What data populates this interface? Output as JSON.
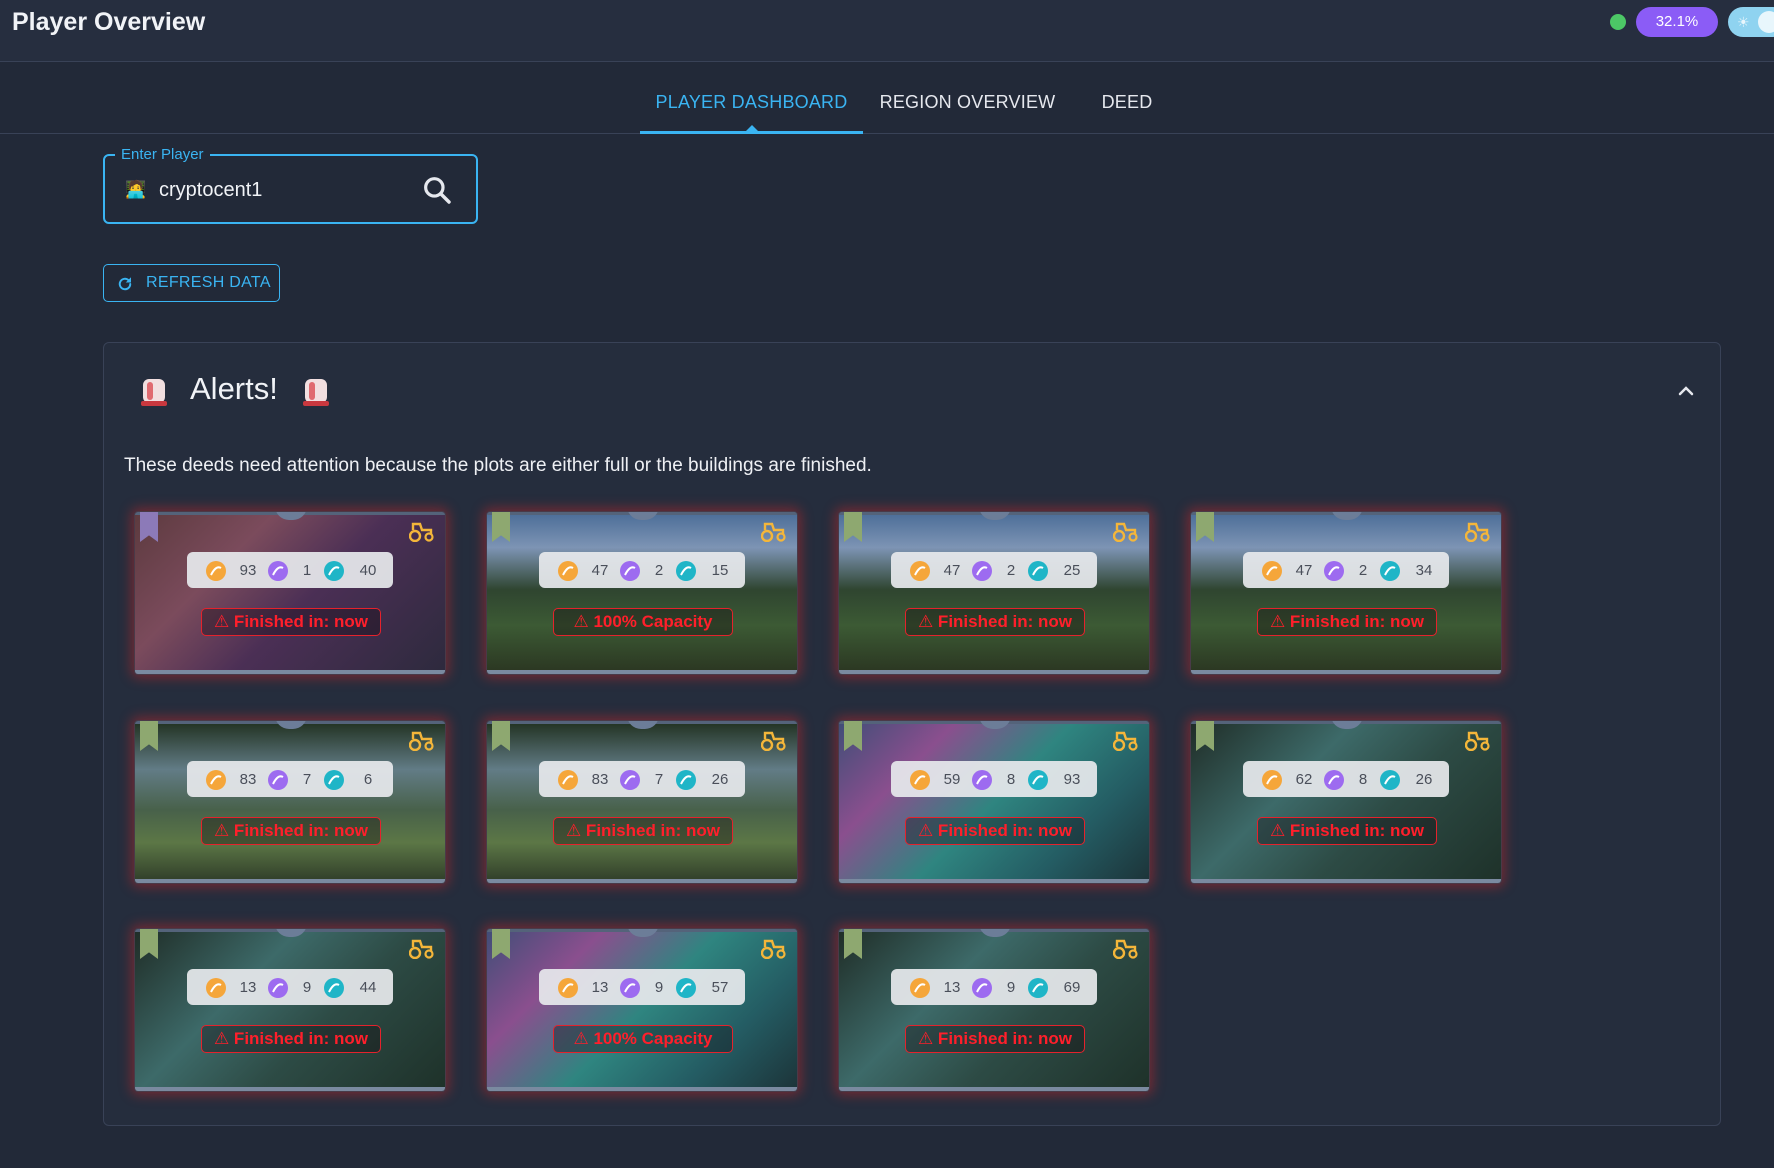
{
  "app": {
    "title": "Player Overview",
    "progress_chip": "32.1%",
    "status_color": "#4cc766",
    "chip_color": "#8b5cf6",
    "accent_color": "#3ab4f2"
  },
  "tabs": [
    {
      "label": "PLAYER DASHBOARD",
      "active": true
    },
    {
      "label": "REGION OVERVIEW",
      "active": false
    },
    {
      "label": "DEED",
      "active": false
    }
  ],
  "player_input": {
    "legend": "Enter Player",
    "value": "cryptocent1"
  },
  "refresh_button": {
    "label": "REFRESH DATA"
  },
  "alerts": {
    "title": "Alerts!",
    "description": "These deeds need attention because the plots are either full or the buildings are finished.",
    "cards": [
      {
        "biome": "death",
        "banner": "purple",
        "grain": "93",
        "research": "1",
        "spellpower": "40",
        "alert": "⚠ Finished in: now"
      },
      {
        "biome": "forest",
        "banner": "green",
        "grain": "47",
        "research": "2",
        "spellpower": "15",
        "alert": "⚠ 100% Capacity"
      },
      {
        "biome": "forest",
        "banner": "green",
        "grain": "47",
        "research": "2",
        "spellpower": "25",
        "alert": "⚠ Finished in: now"
      },
      {
        "biome": "forest",
        "banner": "green",
        "grain": "47",
        "research": "2",
        "spellpower": "34",
        "alert": "⚠ Finished in: now"
      },
      {
        "biome": "swamp",
        "banner": "green",
        "grain": "83",
        "research": "7",
        "spellpower": "6",
        "alert": "⚠ Finished in: now"
      },
      {
        "biome": "swamp",
        "banner": "green",
        "grain": "83",
        "research": "7",
        "spellpower": "26",
        "alert": "⚠ Finished in: now"
      },
      {
        "biome": "lake",
        "banner": "green",
        "grain": "59",
        "research": "8",
        "spellpower": "93",
        "alert": "⚠ Finished in: now"
      },
      {
        "biome": "jungle",
        "banner": "green",
        "grain": "62",
        "research": "8",
        "spellpower": "26",
        "alert": "⚠ Finished in: now"
      },
      {
        "biome": "jungle",
        "banner": "green",
        "grain": "13",
        "research": "9",
        "spellpower": "44",
        "alert": "⚠ Finished in: now"
      },
      {
        "biome": "lake",
        "banner": "green",
        "grain": "13",
        "research": "9",
        "spellpower": "57",
        "alert": "⚠ 100% Capacity"
      },
      {
        "biome": "jungle",
        "banner": "green",
        "grain": "13",
        "research": "9",
        "spellpower": "69",
        "alert": "⚠ Finished in: now"
      }
    ]
  }
}
